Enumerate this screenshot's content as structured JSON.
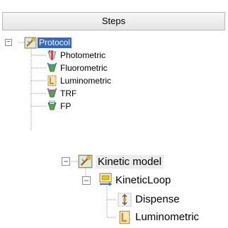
{
  "header": {
    "title": "Steps"
  },
  "tree1": {
    "root": {
      "label": "Protocol",
      "expander": "−",
      "icon": "protocol-wand-icon"
    },
    "children": [
      {
        "label": "Photometric",
        "icon": "photometric-icon"
      },
      {
        "label": "Fluorometric",
        "icon": "fluorometric-icon"
      },
      {
        "label": "Luminometric",
        "icon": "luminometric-icon"
      },
      {
        "label": "TRF",
        "icon": "trf-icon"
      },
      {
        "label": "FP",
        "icon": "fp-icon"
      }
    ]
  },
  "tree2": {
    "root": {
      "label": "Kinetic model",
      "expander": "−",
      "icon": "protocol-wand-icon"
    },
    "loop": {
      "label": "KineticLoop",
      "expander": "−",
      "icon": "kinetic-loop-icon"
    },
    "children": [
      {
        "label": "Dispense",
        "icon": "dispense-icon"
      },
      {
        "label": "Luminometric",
        "icon": "luminometric-icon"
      }
    ]
  },
  "colors": {
    "selection": "#3167c6",
    "header_border": "#b9b9b9"
  }
}
